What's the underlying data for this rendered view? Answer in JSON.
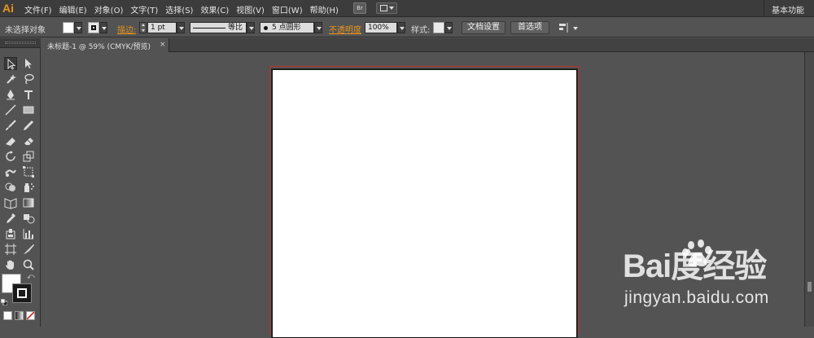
{
  "app": {
    "logo": "Ai",
    "menus": [
      "文件(F)",
      "编辑(E)",
      "对象(O)",
      "文字(T)",
      "选择(S)",
      "效果(C)",
      "视图(V)",
      "窗口(W)",
      "帮助(H)"
    ],
    "bridge_label": "Br",
    "workspace": "基本功能"
  },
  "control": {
    "selection_status": "未选择对象",
    "stroke_label": "描边:",
    "stroke_weight": "1 pt",
    "profile_label": "等比",
    "brush_label": "5 点圆形",
    "opacity_label": "不透明度",
    "opacity_value": "100%",
    "style_label": "样式:",
    "doc_setup_button": "文档设置",
    "prefs_button": "首选项",
    "accent_color": "#e6941e"
  },
  "document": {
    "tab_title": "未标题-1 @ 59% (CMYK/预览)",
    "tab_close": "×"
  },
  "watermark": {
    "logo_text": "Bai度经验",
    "url": "jingyan.baidu.com"
  }
}
